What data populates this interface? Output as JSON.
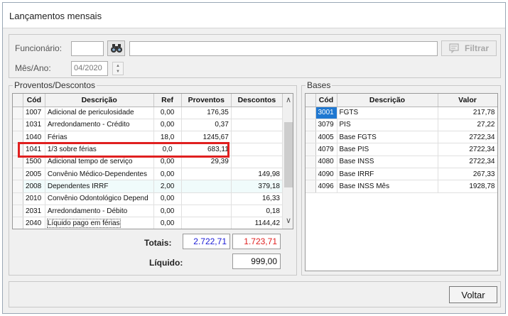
{
  "window": {
    "title": "Lançamentos mensais"
  },
  "filters": {
    "funcionario_label": "Funcionário:",
    "funcionario_value": "",
    "funcionario_name": "",
    "mesano_label": "Mês/Ano:",
    "mesano_value": "04/2020",
    "filter_button": "Filtrar"
  },
  "proventos": {
    "legend": "Proventos/Descontos",
    "columns": [
      "Cód",
      "Descrição",
      "Ref",
      "Proventos",
      "Descontos"
    ],
    "rows": [
      {
        "cod": "1007",
        "desc": "Adicional de periculosidade",
        "ref": "0,00",
        "prov": "176,35",
        "desc_val": ""
      },
      {
        "cod": "1031",
        "desc": "Arredondamento - Crédito",
        "ref": "0,00",
        "prov": "0,37",
        "desc_val": ""
      },
      {
        "cod": "1040",
        "desc": "Férias",
        "ref": "18,0",
        "prov": "1245,67",
        "desc_val": ""
      },
      {
        "cod": "1041",
        "desc": "1/3 sobre férias",
        "ref": "0,0",
        "prov": "683,11",
        "desc_val": ""
      },
      {
        "cod": "1500",
        "desc": "Adicional tempo de serviço",
        "ref": "0,00",
        "prov": "29,39",
        "desc_val": ""
      },
      {
        "cod": "2005",
        "desc": "Convênio Médico-Dependentes",
        "ref": "0,00",
        "prov": "",
        "desc_val": "149,98"
      },
      {
        "cod": "2008",
        "desc": "Dependentes IRRF",
        "ref": "2,00",
        "prov": "",
        "desc_val": "379,18"
      },
      {
        "cod": "2010",
        "desc": "Convênio Odontológico Depend",
        "ref": "0,00",
        "prov": "",
        "desc_val": "16,33"
      },
      {
        "cod": "2031",
        "desc": "Arredondamento - Débito",
        "ref": "0,00",
        "prov": "",
        "desc_val": "0,18"
      },
      {
        "cod": "2040",
        "desc": "Líquido pago em férias",
        "ref": "0,00",
        "prov": "",
        "desc_val": "1144,42"
      }
    ],
    "totais_label": "Totais:",
    "total_proventos": "2.722,71",
    "total_descontos": "1.723,71",
    "liquido_label": "Líquido:",
    "liquido_value": "999,00"
  },
  "bases": {
    "legend": "Bases",
    "columns": [
      "Cód",
      "Descrição",
      "Valor"
    ],
    "rows": [
      {
        "cod": "3001",
        "desc": "FGTS",
        "valor": "217,78"
      },
      {
        "cod": "3079",
        "desc": "PIS",
        "valor": "27,22"
      },
      {
        "cod": "4005",
        "desc": "Base FGTS",
        "valor": "2722,34"
      },
      {
        "cod": "4079",
        "desc": "Base PIS",
        "valor": "2722,34"
      },
      {
        "cod": "4080",
        "desc": "Base INSS",
        "valor": "2722,34"
      },
      {
        "cod": "4090",
        "desc": "Base IRRF",
        "valor": "267,33"
      },
      {
        "cod": "4096",
        "desc": "Base INSS Mês",
        "valor": "1928,78"
      }
    ]
  },
  "footer": {
    "voltar_button": "Voltar"
  },
  "colors": {
    "proventos_total": "#1a1ad6",
    "descontos_total": "#e02020",
    "highlight_box": "#e02020",
    "selected_code": "#1f78d1"
  }
}
